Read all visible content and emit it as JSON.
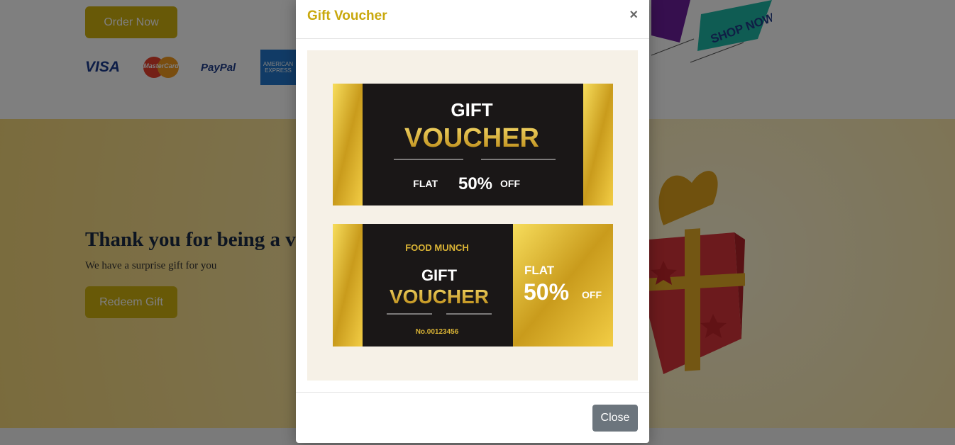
{
  "hero": {
    "order_label": "Order Now",
    "payments": {
      "visa": "VISA",
      "mastercard": "MasterCard",
      "paypal": "PayPal",
      "amex": "AMERICAN EXPRESS"
    },
    "promo_text": "SHOP NOW"
  },
  "gift_section": {
    "title": "Thank you for being a va",
    "subtitle": "We have a surprise gift for you",
    "redeem_label": "Redeem Gift"
  },
  "modal": {
    "title": "Gift Voucher",
    "close_x": "×",
    "close_label": "Close",
    "voucher1": {
      "line1": "GIFT",
      "line2": "VOUCHER",
      "flat": "FLAT",
      "percent": "50%",
      "off": "OFF"
    },
    "voucher2": {
      "brand": "FOOD MUNCH",
      "line1": "GIFT",
      "line2": "VOUCHER",
      "number": "No.00123456",
      "flat": "FLAT",
      "percent": "50%",
      "off": "OFF"
    }
  },
  "colors": {
    "accent": "#d0b20f",
    "title_gold": "#c9a80d",
    "close_gray": "#6c757d",
    "voucher_dark": "#1a1717"
  }
}
